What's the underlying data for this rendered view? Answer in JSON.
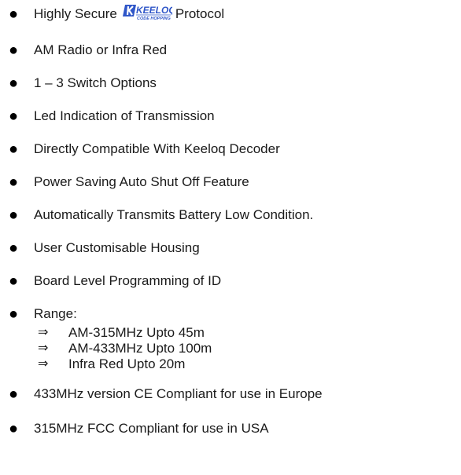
{
  "features": [
    {
      "before": "Highly Secure",
      "logo": {
        "main": "KEELOQ",
        "sub": "CODE HOPPING"
      },
      "after": "Protocol"
    },
    {
      "text": "AM Radio or Infra Red"
    },
    {
      "text": "1 – 3 Switch Options"
    },
    {
      "text": "Led Indication of Transmission"
    },
    {
      "text": "Directly Compatible With Keeloq Decoder"
    },
    {
      "text": "Power Saving Auto Shut Off Feature"
    },
    {
      "text": "Automatically Transmits Battery Low Condition."
    },
    {
      "text": "User Customisable Housing"
    },
    {
      "text": "Board Level Programming of ID"
    },
    {
      "text": "Range:"
    },
    {
      "text": "433MHz version CE Compliant for use in Europe"
    },
    {
      "text": "315MHz FCC Compliant for use in USA"
    }
  ],
  "range_items": [
    "AM-315MHz Upto 45m",
    "AM-433MHz Upto 100m",
    "Infra Red Upto 20m"
  ],
  "glyphs": {
    "bullet": "●",
    "arrow": "⇒"
  },
  "colors": {
    "logo_blue": "#2f56c8",
    "text": "#1a1a1a"
  }
}
